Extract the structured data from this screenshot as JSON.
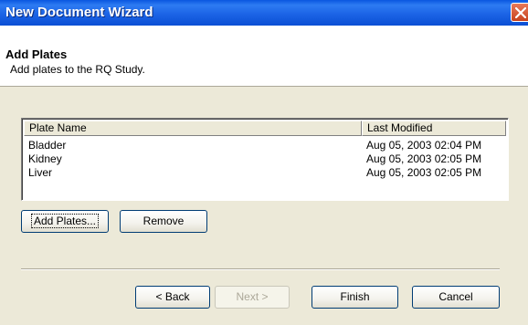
{
  "window": {
    "title": "New Document Wizard"
  },
  "header": {
    "title": "Add Plates",
    "subtitle": "Add plates to the RQ Study."
  },
  "plates_list": {
    "columns": [
      "Plate Name",
      "Last Modified"
    ],
    "rows": [
      {
        "name": "Bladder",
        "modified": "Aug 05, 2003 02:04 PM"
      },
      {
        "name": "Kidney",
        "modified": "Aug 05, 2003 02:05 PM"
      },
      {
        "name": "Liver",
        "modified": "Aug 05, 2003 02:05 PM"
      }
    ]
  },
  "actions": {
    "add_plates": "Add Plates...",
    "remove": "Remove"
  },
  "navigation": {
    "back": "< Back",
    "next": "Next >",
    "finish": "Finish",
    "cancel": "Cancel"
  }
}
